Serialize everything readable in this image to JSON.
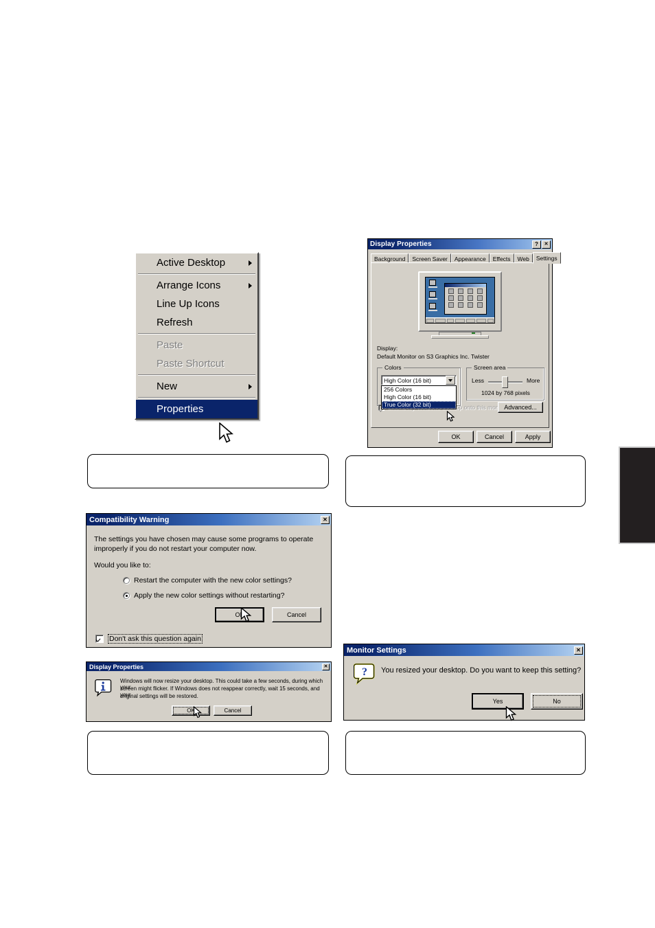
{
  "context_menu": {
    "groups": [
      [
        {
          "label": "Active Desktop",
          "submenu": true,
          "disabled": false,
          "selected": false
        }
      ],
      [
        {
          "label": "Arrange Icons",
          "submenu": true,
          "disabled": false,
          "selected": false
        },
        {
          "label": "Line Up Icons",
          "submenu": false,
          "disabled": false,
          "selected": false
        },
        {
          "label": "Refresh",
          "submenu": false,
          "disabled": false,
          "selected": false
        }
      ],
      [
        {
          "label": "Paste",
          "submenu": false,
          "disabled": true,
          "selected": false
        },
        {
          "label": "Paste Shortcut",
          "submenu": false,
          "disabled": true,
          "selected": false
        }
      ],
      [
        {
          "label": "New",
          "submenu": true,
          "disabled": false,
          "selected": false
        }
      ],
      [
        {
          "label": "Properties",
          "submenu": false,
          "disabled": false,
          "selected": true
        }
      ]
    ]
  },
  "display_properties": {
    "title": "Display Properties",
    "help_button": "?",
    "close_button": "✕",
    "tabs": [
      {
        "label": "Background",
        "active": false
      },
      {
        "label": "Screen Saver",
        "active": false
      },
      {
        "label": "Appearance",
        "active": false
      },
      {
        "label": "Effects",
        "active": false
      },
      {
        "label": "Web",
        "active": false
      },
      {
        "label": "Settings",
        "active": true
      }
    ],
    "display_label": "Display:",
    "display_value": "Default Monitor on S3 Graphics Inc. Twister",
    "colors": {
      "group_title": "Colors",
      "selected": "High Color (16 bit)",
      "options": [
        {
          "label": "256 Colors",
          "selected": false
        },
        {
          "label": "High Color (16 bit)",
          "selected": false
        },
        {
          "label": "True Color (32 bit)",
          "selected": true
        }
      ]
    },
    "screen_area": {
      "group_title": "Screen area",
      "less_label": "Less",
      "more_label": "More",
      "value_label": "1024 by 768 pixels"
    },
    "extend_checkbox": {
      "label": "Extend my Windows desktop onto this monitor.",
      "checked": true,
      "disabled": true
    },
    "advanced_button": "Advanced...",
    "buttons": {
      "ok": "OK",
      "cancel": "Cancel",
      "apply": "Apply"
    }
  },
  "compatibility_warning": {
    "title": "Compatibility Warning",
    "close_button": "✕",
    "body_line1": "The settings you have chosen may cause some programs to operate",
    "body_line2": "improperly if you do not restart your computer now.",
    "question": "Would you like to:",
    "options": [
      {
        "label": "Restart the computer with the new color settings?",
        "accel": "R",
        "selected": false
      },
      {
        "label": "Apply the new color settings without restarting?",
        "accel": "A",
        "selected": true
      }
    ],
    "ok_button": "OK",
    "cancel_button": "Cancel",
    "dont_ask": {
      "label": "Don't ask this question again",
      "accel": "D",
      "checked": true
    }
  },
  "display_resize_dialog": {
    "title": "Display Properties",
    "close_button": "✕",
    "icon": "info-icon",
    "body_line1": "Windows will now resize your desktop. This could take a few seconds, during which your",
    "body_line2": "screen might flicker.  If Windows does not reappear correctly, wait 15 seconds, and your",
    "body_line3": "original settings will be restored.",
    "ok_button": "OK",
    "cancel_button": "Cancel"
  },
  "monitor_settings_dialog": {
    "title": "Monitor Settings",
    "close_button": "✕",
    "icon": "question-icon",
    "message": "You resized your desktop.  Do you want to keep this setting?",
    "yes_button": "Yes",
    "yes_accel": "Y",
    "no_button": "No",
    "no_accel": "N"
  },
  "caption_boxes": [
    {
      "id": "caption-left-top",
      "text": ""
    },
    {
      "id": "caption-right-top",
      "text": ""
    },
    {
      "id": "caption-left-bottom",
      "text": ""
    },
    {
      "id": "caption-right-bottom",
      "text": ""
    }
  ],
  "colors": {
    "title_bar_start": "#0a246a",
    "title_bar_end": "#a6caf0",
    "dialog_face": "#d4d0c8",
    "highlight": "#0a246a",
    "desktop_blue": "#3a6ea5",
    "edge_tab": "#231f20"
  }
}
